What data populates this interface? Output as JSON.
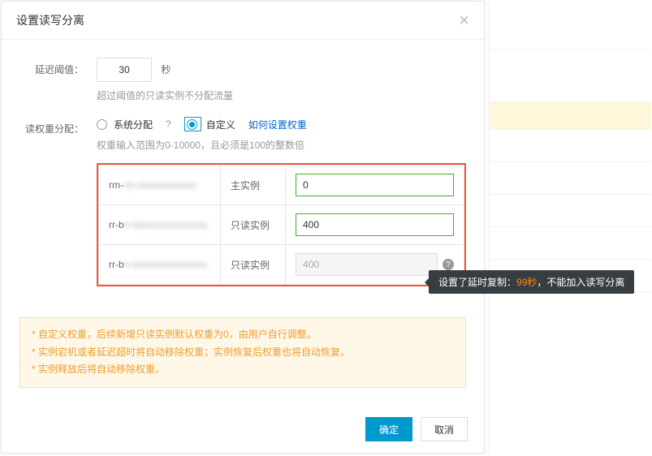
{
  "modal": {
    "title": "设置读写分离",
    "delay": {
      "label": "延迟阈值：",
      "value": "30",
      "unit": "秒",
      "hint": "超过阈值的只读实例不分配流量"
    },
    "weight": {
      "label": "读权重分配：",
      "opt_system": "系统分配",
      "opt_custom": "自定义",
      "link": "如何设置权重",
      "hint": "权重输入范围为0-10000，且必须是100的整数倍"
    },
    "table": {
      "rows": [
        {
          "id": "rm-xxxxxxxxxxxx",
          "type": "主实例",
          "value": "0",
          "disabled": false,
          "help": false
        },
        {
          "id": "rr-bxxxxxxxxxxxxxx",
          "type": "只读实例",
          "value": "400",
          "disabled": false,
          "help": false
        },
        {
          "id": "rr-bxxxxxxxxxxxxxx",
          "type": "只读实例",
          "value": "400",
          "disabled": true,
          "help": true
        }
      ]
    },
    "tooltip": {
      "prefix": "设置了延时复制：",
      "seconds": "99秒",
      "suffix": "，不能加入读写分离"
    },
    "warnings": [
      "* 自定义权重，后续新增只读实例默认权重为0，由用户自行调整。",
      "* 实例宕机或者延迟超时将自动移除权重；实例恢复后权重也将自动恢复。",
      "* 实例释放后将自动移除权重。"
    ],
    "buttons": {
      "ok": "确定",
      "cancel": "取消"
    }
  }
}
